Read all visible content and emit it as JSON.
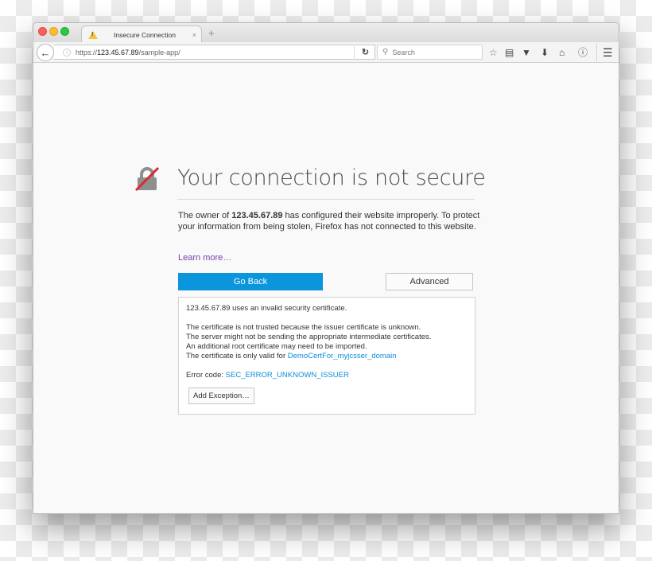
{
  "browser": {
    "tab": {
      "title": "Insecure Connection",
      "icon": "warning-icon",
      "close": "×"
    },
    "new_tab": "+",
    "url": {
      "scheme": "https://",
      "host": "123.45.67.89",
      "path": "/sample-app/"
    },
    "search_placeholder": "Search",
    "toolbar_icons": [
      "star-icon",
      "reading-list-icon",
      "pocket-icon",
      "download-icon",
      "home-icon",
      "info-icon",
      "menu-icon"
    ]
  },
  "page": {
    "title": "Your connection is not secure",
    "desc_prefix": "The owner of ",
    "desc_host": "123.45.67.89",
    "desc_suffix": " has configured their website improperly. To protect your information from being stolen, Firefox has not connected to this website.",
    "learn_more": "Learn more…",
    "go_back": "Go Back",
    "advanced": "Advanced",
    "panel": {
      "line1": "123.45.67.89 uses an invalid security certificate.",
      "line2": "The certificate is not trusted because the issuer certificate is unknown.",
      "line3": "The server might not be sending the appropriate intermediate certificates.",
      "line4": "An additional root certificate may need to be imported.",
      "line5_prefix": "The certificate is only valid for ",
      "line5_link": "DemoCertFor_myjcsser_domain",
      "error_prefix": "Error code: ",
      "error_code": "SEC_ERROR_UNKNOWN_ISSUER",
      "add_exception": "Add Exception…"
    }
  },
  "colors": {
    "primary_button": "#0a95dd",
    "link": "#0a8dd6",
    "learn_more": "#7a3fa8",
    "lock_strike": "#d92d2d"
  }
}
